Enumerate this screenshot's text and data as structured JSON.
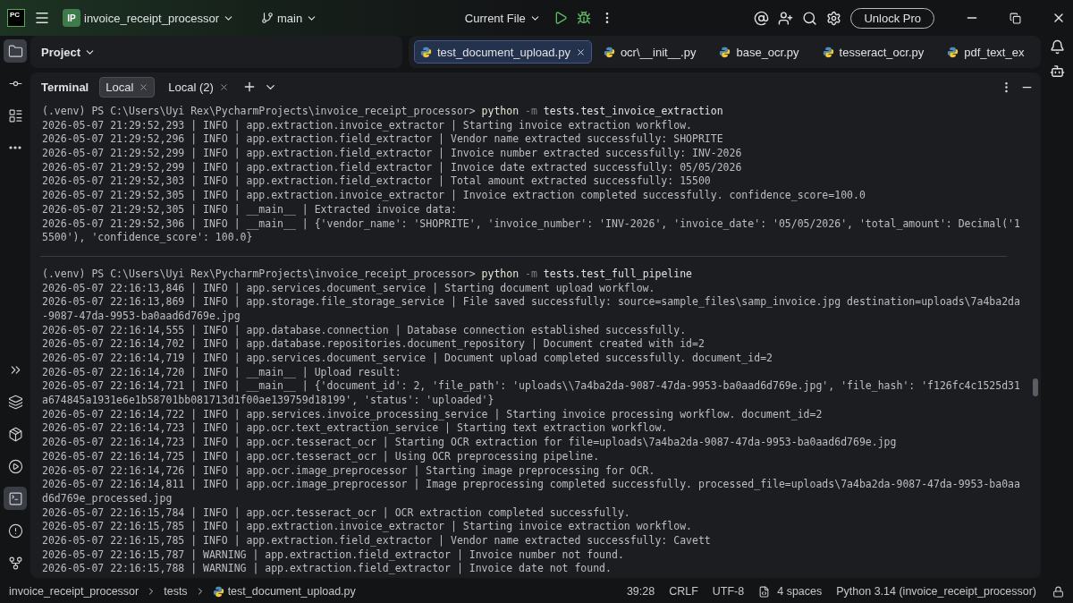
{
  "title_bar": {
    "logo": "PC",
    "project_badge": "IP",
    "project": "invoice_receipt_processor",
    "branch": "main",
    "run_config": "Current File",
    "unlock": "Unlock Pro"
  },
  "left_toolbar": {
    "top": [
      {
        "kind": "folder",
        "selected": true
      },
      {
        "kind": "commit",
        "selected": false
      },
      {
        "kind": "structure",
        "selected": false
      },
      {
        "kind": "more",
        "selected": false
      }
    ],
    "bottom": [
      {
        "kind": "expand",
        "selected": false
      },
      {
        "kind": "python",
        "selected": false
      },
      {
        "kind": "packages",
        "selected": false
      },
      {
        "kind": "run",
        "selected": false
      },
      {
        "kind": "terminal",
        "selected": true
      },
      {
        "kind": "problems",
        "selected": false
      },
      {
        "kind": "git",
        "selected": false
      }
    ]
  },
  "project_panel": {
    "title": "Project"
  },
  "editor_tabs": [
    {
      "label": "test_document_upload.py",
      "selected": true
    },
    {
      "label": "ocr\\__init__.py",
      "selected": false
    },
    {
      "label": "base_ocr.py",
      "selected": false
    },
    {
      "label": "tesseract_ocr.py",
      "selected": false
    },
    {
      "label": "pdf_text_ex",
      "selected": false
    }
  ],
  "terminal": {
    "title": "Terminal",
    "tabs": [
      {
        "label": "Local",
        "selected": true
      },
      {
        "label": "Local (2)",
        "selected": false
      }
    ],
    "sessions": [
      {
        "lines": [
          {
            "kind": "prompt",
            "prompt": "(.venv) PS C:\\Users\\Uyi Rex\\PycharmProjects\\invoice_receipt_processor> ",
            "command": "python",
            "flag": "-m",
            "args": "tests.test_invoice_extraction"
          },
          {
            "kind": "log",
            "text": "2026-05-07 21:29:52,293 | INFO | app.extraction.invoice_extractor | Starting invoice extraction workflow."
          },
          {
            "kind": "log",
            "text": "2026-05-07 21:29:52,296 | INFO | app.extraction.field_extractor | Vendor name extracted successfully: SHOPRITE"
          },
          {
            "kind": "log",
            "text": "2026-05-07 21:29:52,299 | INFO | app.extraction.field_extractor | Invoice number extracted successfully: INV-2026"
          },
          {
            "kind": "log",
            "text": "2026-05-07 21:29:52,299 | INFO | app.extraction.field_extractor | Invoice date extracted successfully: 05/05/2026"
          },
          {
            "kind": "log",
            "text": "2026-05-07 21:29:52,303 | INFO | app.extraction.field_extractor | Total amount extracted successfully: 15500"
          },
          {
            "kind": "log",
            "text": "2026-05-07 21:29:52,305 | INFO | app.extraction.invoice_extractor | Invoice extraction completed successfully. confidence_score=100.0"
          },
          {
            "kind": "log",
            "text": "2026-05-07 21:29:52,305 | INFO | __main__ | Extracted invoice data:"
          },
          {
            "kind": "log",
            "text": "2026-05-07 21:29:52,306 | INFO | __main__ | {'vendor_name': 'SHOPRITE', 'invoice_number': 'INV-2026', 'invoice_date': '05/05/2026', 'total_amount': Decimal('1"
          },
          {
            "kind": "log",
            "text": "5500'), 'confidence_score': 100.0}"
          }
        ]
      },
      {
        "lines": [
          {
            "kind": "prompt",
            "prompt": "(.venv) PS C:\\Users\\Uyi Rex\\PycharmProjects\\invoice_receipt_processor> ",
            "command": "python",
            "flag": "-m",
            "args": "tests.test_full_pipeline"
          },
          {
            "kind": "log",
            "text": "2026-05-07 22:16:13,846 | INFO | app.services.document_service | Starting document upload workflow."
          },
          {
            "kind": "log",
            "text": "2026-05-07 22:16:13,869 | INFO | app.storage.file_storage_service | File saved successfully: source=sample_files\\samp_invoice.jpg destination=uploads\\7a4ba2da"
          },
          {
            "kind": "log",
            "text": "-9087-47da-9953-ba0aad6d769e.jpg"
          },
          {
            "kind": "log",
            "text": "2026-05-07 22:16:14,555 | INFO | app.database.connection | Database connection established successfully."
          },
          {
            "kind": "log",
            "text": "2026-05-07 22:16:14,702 | INFO | app.database.repositories.document_repository | Document created with id=2"
          },
          {
            "kind": "log",
            "text": "2026-05-07 22:16:14,719 | INFO | app.services.document_service | Document upload completed successfully. document_id=2"
          },
          {
            "kind": "log",
            "text": "2026-05-07 22:16:14,720 | INFO | __main__ | Upload result:"
          },
          {
            "kind": "log",
            "text": "2026-05-07 22:16:14,721 | INFO | __main__ | {'document_id': 2, 'file_path': 'uploads\\\\7a4ba2da-9087-47da-9953-ba0aad6d769e.jpg', 'file_hash': 'f126fc4c1525d31"
          },
          {
            "kind": "log",
            "text": "a674845a1931e6e1b58701bb081713d1f00ae139759d18199', 'status': 'uploaded'}"
          },
          {
            "kind": "log",
            "text": "2026-05-07 22:16:14,722 | INFO | app.services.invoice_processing_service | Starting invoice processing workflow. document_id=2"
          },
          {
            "kind": "log",
            "text": "2026-05-07 22:16:14,723 | INFO | app.ocr.text_extraction_service | Starting text extraction workflow."
          },
          {
            "kind": "log",
            "text": "2026-05-07 22:16:14,723 | INFO | app.ocr.tesseract_ocr | Starting OCR extraction for file=uploads\\7a4ba2da-9087-47da-9953-ba0aad6d769e.jpg"
          },
          {
            "kind": "log",
            "text": "2026-05-07 22:16:14,725 | INFO | app.ocr.tesseract_ocr | Using OCR preprocessing pipeline."
          },
          {
            "kind": "log",
            "text": "2026-05-07 22:16:14,726 | INFO | app.ocr.image_preprocessor | Starting image preprocessing for OCR."
          },
          {
            "kind": "log",
            "text": "2026-05-07 22:16:14,811 | INFO | app.ocr.image_preprocessor | Image preprocessing completed successfully. processed_file=uploads\\7a4ba2da-9087-47da-9953-ba0aa"
          },
          {
            "kind": "log",
            "text": "d6d769e_processed.jpg"
          },
          {
            "kind": "log",
            "text": "2026-05-07 22:16:15,784 | INFO | app.ocr.tesseract_ocr | OCR extraction completed successfully."
          },
          {
            "kind": "log",
            "text": "2026-05-07 22:16:15,785 | INFO | app.extraction.invoice_extractor | Starting invoice extraction workflow."
          },
          {
            "kind": "log",
            "text": "2026-05-07 22:16:15,785 | INFO | app.extraction.field_extractor | Vendor name extracted successfully: Cavett"
          },
          {
            "kind": "log",
            "text": "2026-05-07 22:16:15,787 | WARNING | app.extraction.field_extractor | Invoice number not found."
          },
          {
            "kind": "log",
            "text": "2026-05-07 22:16:15,788 | WARNING | app.extraction.field_extractor | Invoice date not found."
          }
        ]
      }
    ]
  },
  "status_bar": {
    "breadcrumbs": [
      "invoice_receipt_processor",
      "tests",
      "test_document_upload.py"
    ],
    "position": "39:28",
    "line_ending": "CRLF",
    "encoding": "UTF-8",
    "indent": "4 spaces",
    "interpreter": "Python 3.14 (invoice_receipt_processor)"
  }
}
